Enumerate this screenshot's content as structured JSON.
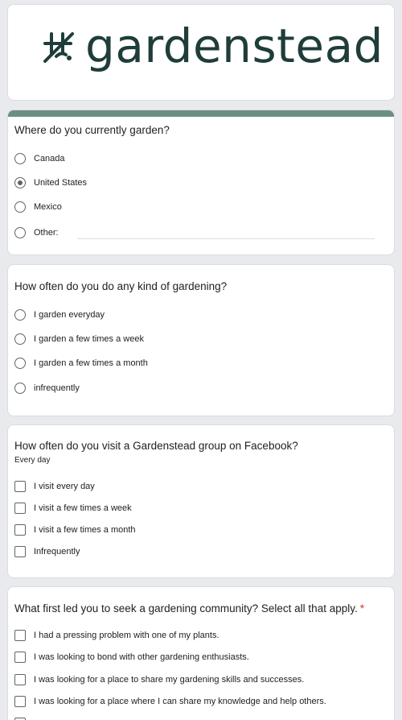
{
  "header": {
    "logo_text": "gardenstead"
  },
  "colors": {
    "accent": "#6b8f84",
    "logo": "#1f3d3a",
    "required": "#d93025"
  },
  "questions": [
    {
      "title": "Where do you currently garden?",
      "type": "radio",
      "options": [
        {
          "label": "Canada",
          "selected": false
        },
        {
          "label": "United States",
          "selected": true
        },
        {
          "label": "Mexico",
          "selected": false
        },
        {
          "label": "Other:",
          "selected": false
        }
      ],
      "other_value": ""
    },
    {
      "title": "How often do you do any kind of gardening?",
      "type": "radio",
      "options": [
        {
          "label": "I garden everyday",
          "selected": false
        },
        {
          "label": "I garden a few times a week",
          "selected": false
        },
        {
          "label": "I garden a few times a month",
          "selected": false
        },
        {
          "label": "infrequently",
          "selected": false
        }
      ]
    },
    {
      "title": "How often do you visit a Gardenstead group on Facebook?",
      "subtitle": "Every day",
      "type": "checkbox",
      "options": [
        {
          "label": "I visit every day",
          "checked": false
        },
        {
          "label": "I visit a few times a week",
          "checked": false
        },
        {
          "label": "I visit a few times a month",
          "checked": false
        },
        {
          "label": "Infrequently",
          "checked": false
        }
      ]
    },
    {
      "title": "What first led you to seek a gardening community? Select all that apply.",
      "required_mark": "*",
      "type": "checkbox",
      "options": [
        {
          "label": "I had a pressing problem with one of my plants.",
          "checked": false
        },
        {
          "label": "I was looking to bond with other gardening enthusiasts.",
          "checked": false
        },
        {
          "label": "I was looking for a place to share my gardening skills and successes.",
          "checked": false
        },
        {
          "label": "I was looking for a place where I can share my knowledge and help others.",
          "checked": false
        }
      ]
    }
  ]
}
